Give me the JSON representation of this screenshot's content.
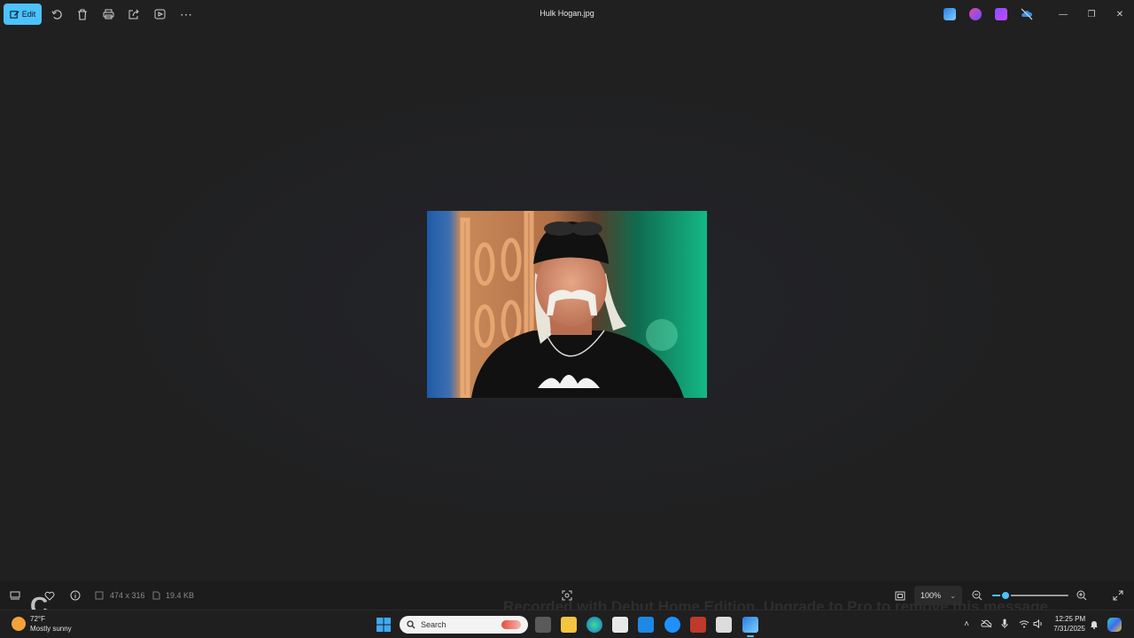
{
  "window": {
    "title": "Hulk Hogan.jpg"
  },
  "toolbar": {
    "edit_label": "Edit",
    "icons": [
      "rotate-icon",
      "delete-icon",
      "print-icon",
      "share-icon",
      "slideshow-icon",
      "more-icon"
    ],
    "more_label": "⋯"
  },
  "window_controls": {
    "minimize": "—",
    "restore": "❐",
    "close": "✕"
  },
  "status": {
    "dimensions": "474 x 316",
    "file_size": "19.4 KB",
    "zoom": "100%",
    "zoom_level": 0.17
  },
  "watermark": {
    "text": "Recorded with Debut Home Edition. Upgrade to Pro to remove this message"
  },
  "logo_letter": "C",
  "taskbar": {
    "weather_temp": "72°F",
    "weather_condition": "Mostly sunny",
    "search_label": "Search",
    "time": "12:25 PM",
    "date": "7/31/2025"
  },
  "colors": {
    "accent": "#4cc2ff",
    "background": "#202020"
  }
}
